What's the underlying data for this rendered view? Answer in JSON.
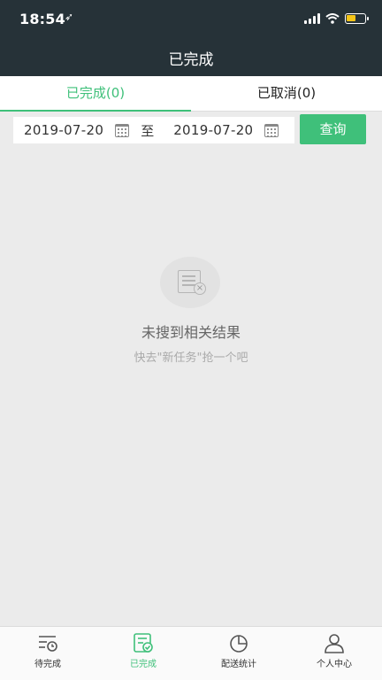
{
  "status_bar": {
    "time": "18:54",
    "location_glyph": "➶",
    "battery_percent": 55,
    "battery_color": "#f5c518"
  },
  "header": {
    "title": "已完成"
  },
  "tabs": [
    {
      "label": "已完成(0)",
      "active": true
    },
    {
      "label": "已取消(0)",
      "active": false
    }
  ],
  "filter": {
    "start_date": "2019-07-20",
    "separator": "至",
    "end_date": "2019-07-20",
    "query_label": "查询"
  },
  "empty_state": {
    "title": "未搜到相关结果",
    "subtitle": "快去\"新任务\"抢一个吧"
  },
  "bottom_nav": [
    {
      "label": "待完成",
      "icon": "pending-list-icon",
      "active": false
    },
    {
      "label": "已完成",
      "icon": "completed-list-icon",
      "active": true
    },
    {
      "label": "配送统计",
      "icon": "pie-chart-icon",
      "active": false
    },
    {
      "label": "个人中心",
      "icon": "user-icon",
      "active": false
    }
  ],
  "colors": {
    "accent": "#3fc07a",
    "header_bg": "#263238",
    "page_bg": "#ebebeb"
  }
}
